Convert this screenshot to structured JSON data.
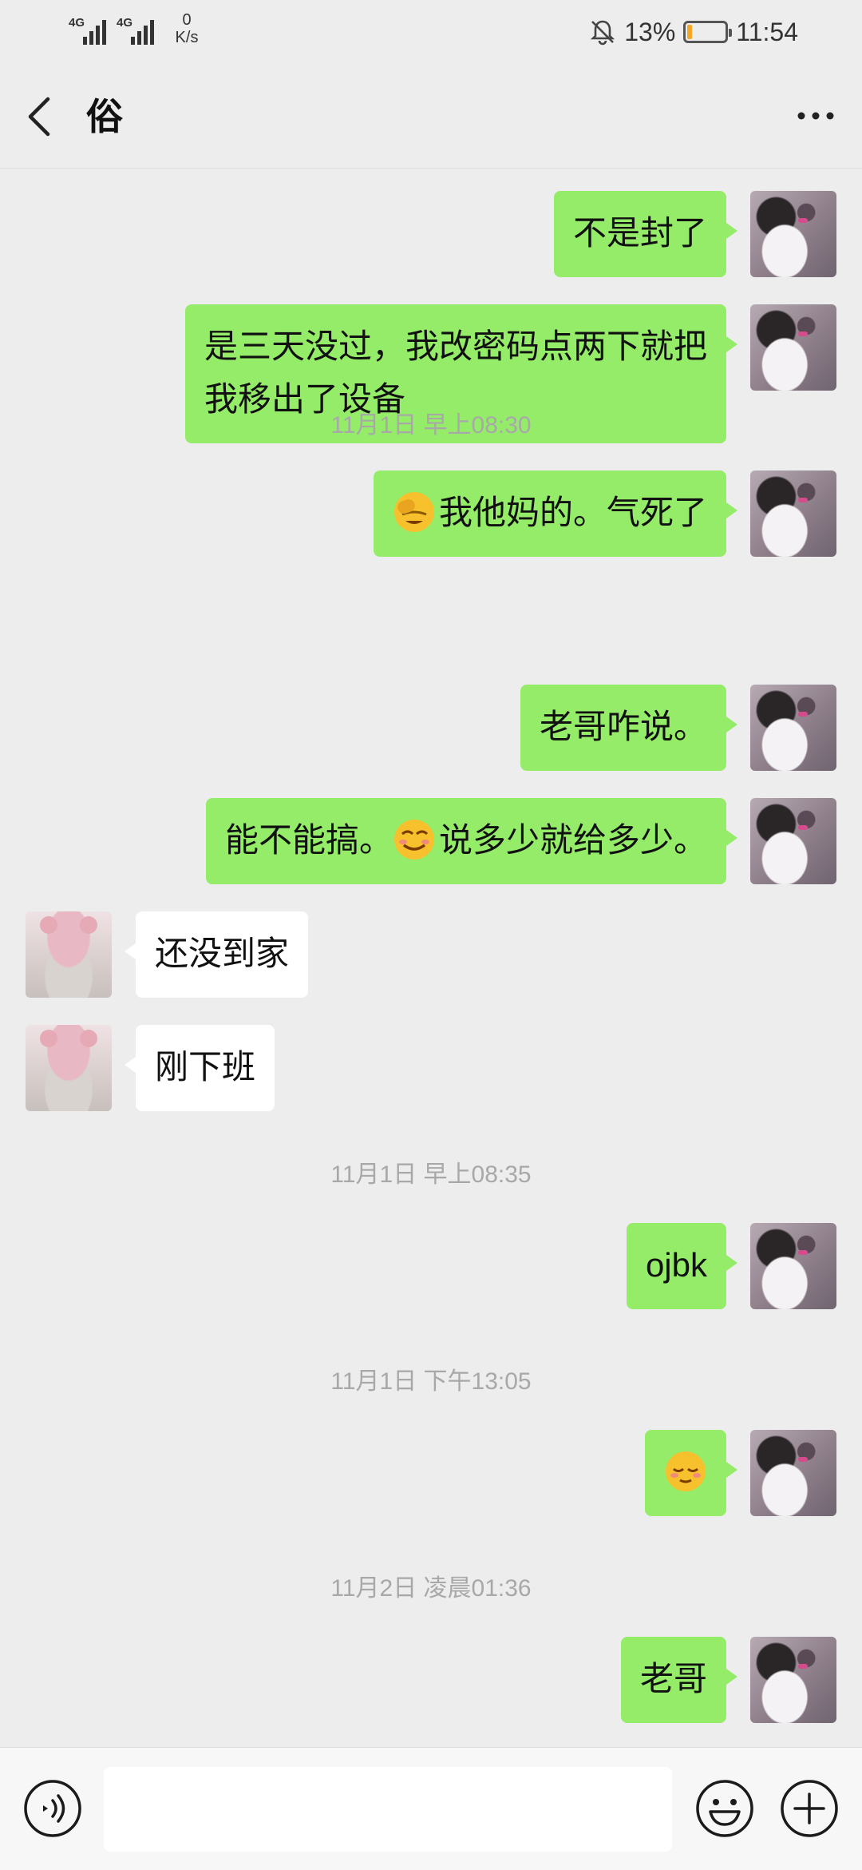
{
  "status_bar": {
    "signal_1": "4G",
    "signal_2": "4G",
    "net_speed_value": "0",
    "net_speed_unit": "K/s",
    "battery_percent": "13%",
    "battery_level": 0.13,
    "time": "11:54",
    "icons": [
      "signal-icon",
      "signal-icon",
      "mute-bell-icon",
      "battery-icon"
    ]
  },
  "header": {
    "title": "俗",
    "back_icon": "back-chevron-icon",
    "more_icon": "more-dots-icon"
  },
  "messages": [
    {
      "type": "msg",
      "sender": "me",
      "text": "不是封了"
    },
    {
      "type": "msg",
      "sender": "me",
      "lines": [
        "是三天没过，我改密码点两下就把",
        "我移出了设备"
      ]
    },
    {
      "type": "msg",
      "sender": "me",
      "emoji": "facepalm-emoji",
      "text": "我他妈的。气死了"
    },
    {
      "type": "time",
      "text": "11月1日 早上08:30"
    },
    {
      "type": "msg",
      "sender": "me",
      "text": "老哥咋说。"
    },
    {
      "type": "msg",
      "sender": "me",
      "pre": "能不能搞。",
      "emoji": "smirk-emoji",
      "post": "说多少就给多少。"
    },
    {
      "type": "msg",
      "sender": "them",
      "text": "还没到家"
    },
    {
      "type": "msg",
      "sender": "them",
      "text": "刚下班"
    },
    {
      "type": "time",
      "text": "11月1日 早上08:35"
    },
    {
      "type": "msg",
      "sender": "me",
      "text": "ojbk"
    },
    {
      "type": "time",
      "text": "11月1日 下午13:05"
    },
    {
      "type": "msg",
      "sender": "me",
      "emoji": "relieved-emoji",
      "text": ""
    },
    {
      "type": "time",
      "text": "11月2日 凌晨01:36"
    },
    {
      "type": "msg",
      "sender": "me",
      "text": "老哥"
    }
  ],
  "input_bar": {
    "value": "",
    "voice_icon": "voice-icon",
    "emoji_icon": "emoji-icon",
    "plus_icon": "plus-icon"
  },
  "colors": {
    "background": "#ededed",
    "my_bubble": "#95ec69",
    "their_bubble": "#ffffff",
    "timestamp_text": "#a8a8a8",
    "battery_fill": "#f5a623"
  }
}
